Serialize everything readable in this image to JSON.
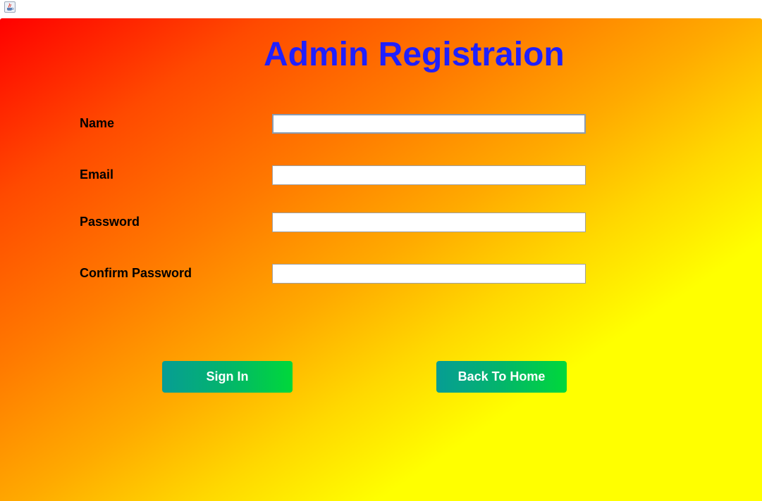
{
  "window": {
    "icon": "java-coffee-cup-icon"
  },
  "form": {
    "title": "Admin Registraion",
    "fields": [
      {
        "label": "Name",
        "value": "",
        "placeholder": ""
      },
      {
        "label": "Email",
        "value": "",
        "placeholder": ""
      },
      {
        "label": "Password",
        "value": "",
        "placeholder": ""
      },
      {
        "label": "Confirm Password",
        "value": "",
        "placeholder": ""
      }
    ]
  },
  "buttons": {
    "sign_in": "Sign In",
    "back_home": "Back To Home"
  },
  "colors": {
    "title": "#1f1fff",
    "gradient_start": "#ff0000",
    "gradient_end": "#ffff00",
    "button_start": "#079d94",
    "button_end": "#00d83a",
    "button_text": "#ffffff"
  }
}
